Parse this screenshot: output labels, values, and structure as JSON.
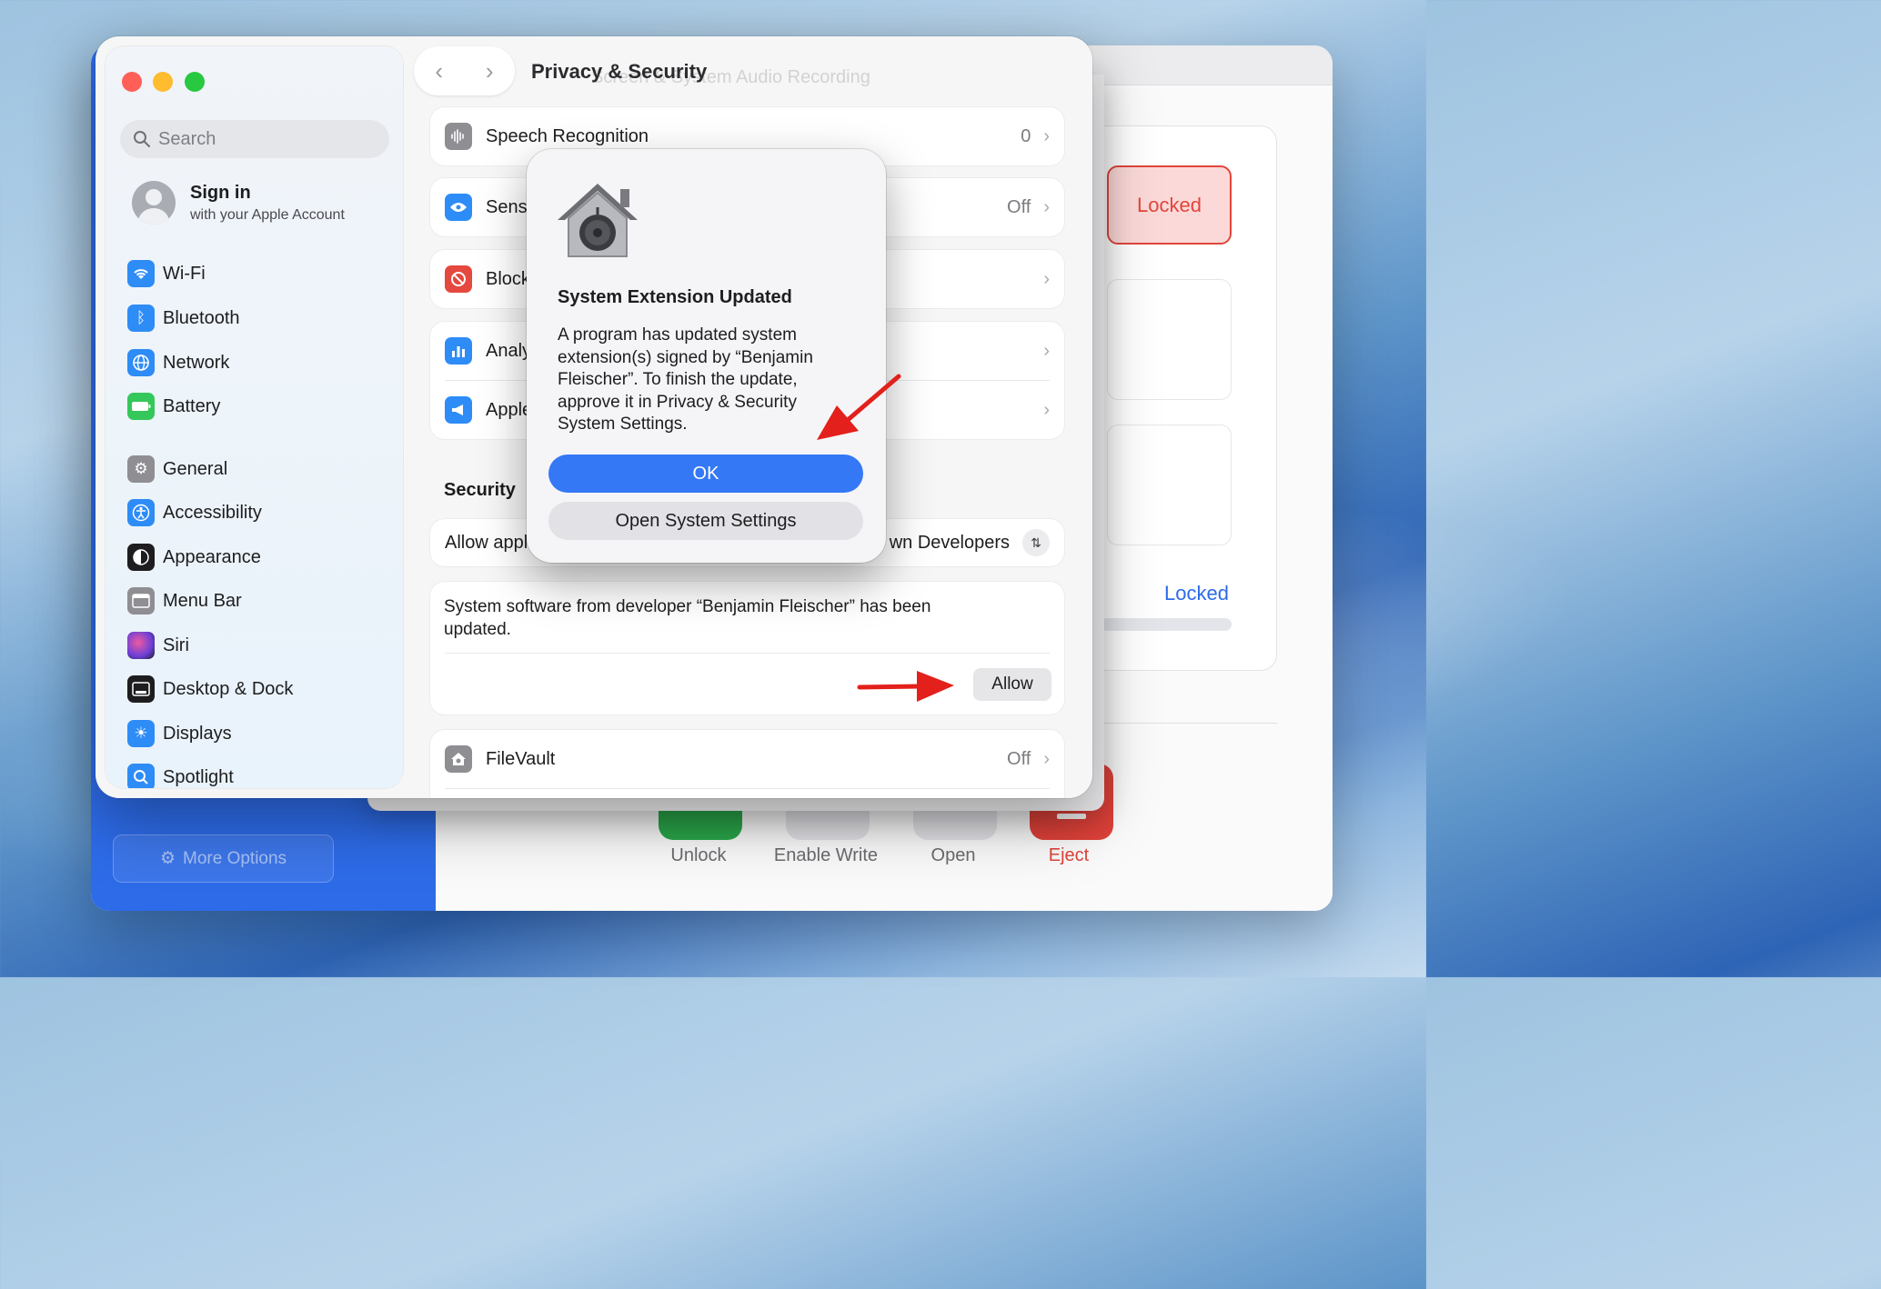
{
  "background_app": {
    "locked_box_label": "Locked",
    "locked_link": "Locked",
    "more_options": "More Options",
    "actions": [
      {
        "label": "Unlock",
        "color": "#2aa84a"
      },
      {
        "label": "Enable Write",
        "color": "#e4e4e8"
      },
      {
        "label": "Open",
        "color": "#e4e4e8"
      },
      {
        "label": "Eject",
        "color": "#e0423a"
      }
    ]
  },
  "window": {
    "title": "Privacy & Security",
    "ghost_text": "Screen & System Audio Recording"
  },
  "sidebar": {
    "search_placeholder": "Search",
    "signin_title": "Sign in",
    "signin_subtitle": "with your Apple Account",
    "items": [
      {
        "label": "Wi-Fi",
        "icon": "wifi-icon",
        "color": "#2e8cf6"
      },
      {
        "label": "Bluetooth",
        "icon": "bluetooth-icon",
        "color": "#2e8cf6"
      },
      {
        "label": "Network",
        "icon": "globe-icon",
        "color": "#2e8cf6"
      },
      {
        "label": "Battery",
        "icon": "battery-icon",
        "color": "#34c759"
      },
      {
        "label": "General",
        "icon": "gear-icon",
        "color": "#8e8e93"
      },
      {
        "label": "Accessibility",
        "icon": "accessibility-icon",
        "color": "#2e8cf6"
      },
      {
        "label": "Appearance",
        "icon": "appearance-icon",
        "color": "#1d1d1f"
      },
      {
        "label": "Menu Bar",
        "icon": "menu-bar-icon",
        "color": "#8e8e93"
      },
      {
        "label": "Siri",
        "icon": "siri-icon",
        "color": "#7b4bd6"
      },
      {
        "label": "Desktop & Dock",
        "icon": "dock-icon",
        "color": "#1d1d1f"
      },
      {
        "label": "Displays",
        "icon": "sun-icon",
        "color": "#2e8cf6"
      },
      {
        "label": "Spotlight",
        "icon": "magnifier-icon",
        "color": "#2e8cf6"
      }
    ]
  },
  "privacy_rows": [
    {
      "label": "Speech Recognition",
      "value": "0",
      "icon": "waveform-icon",
      "color": "#8e8e93"
    },
    {
      "label": "Sens",
      "value": "Off",
      "icon": "eye-icon",
      "color": "#2e8cf6"
    },
    {
      "label": "Block",
      "value": "",
      "icon": "block-icon",
      "color": "#e5483e"
    },
    {
      "label": "Analy",
      "value": "",
      "icon": "chart-icon",
      "color": "#2e8cf6"
    },
    {
      "label": "Apple",
      "value": "",
      "icon": "megaphone-icon",
      "color": "#2e8cf6"
    }
  ],
  "security": {
    "heading": "Security",
    "allow_label": "Allow appl",
    "allow_value": "wn Developers",
    "note": "System software from developer “Benjamin Fleischer” has been updated.",
    "allow_button": "Allow",
    "filevault_label": "FileVault",
    "filevault_value": "Off"
  },
  "dialog": {
    "title": "System Extension Updated",
    "message": "A program has updated system extension(s) signed by “Benjamin Fleischer”. To finish the update, approve it in Privacy & Security System Settings.",
    "ok_button": "OK",
    "open_button": "Open System Settings"
  },
  "colors": {
    "accent": "#3478f6",
    "annotation_arrow": "#e3201b",
    "traffic_close": "#ff5f57",
    "traffic_minimize": "#febc2e",
    "traffic_zoom": "#28c840"
  }
}
